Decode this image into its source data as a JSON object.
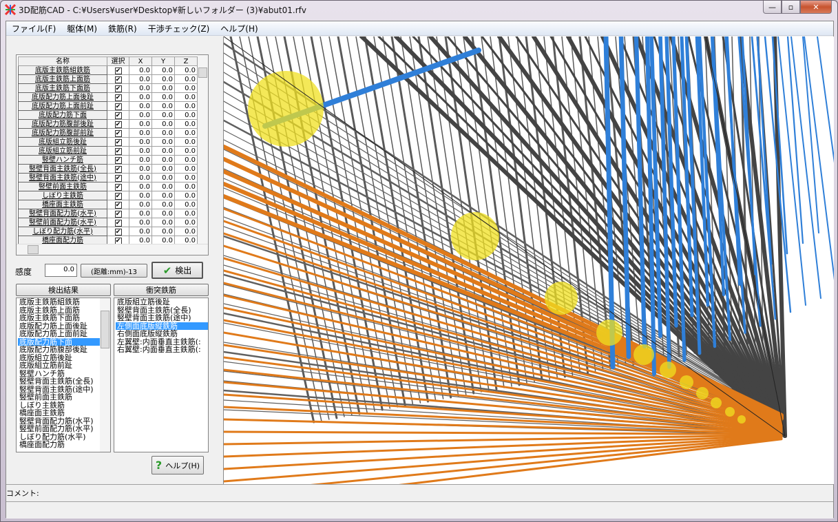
{
  "window": {
    "title": "3D配筋CAD - C:¥Users¥user¥Desktop¥新しいフォルダー (3)¥abut01.rfv",
    "minimize": "—",
    "maximize": "▫",
    "close": "✕"
  },
  "menu": [
    "ファイル(F)",
    "躯体(M)",
    "鉄筋(R)",
    "干渉チェック(Z)",
    "ヘルプ(H)"
  ],
  "table": {
    "headers": [
      "名称",
      "選択",
      "X",
      "Y",
      "Z"
    ],
    "rows": [
      "底版主鉄筋組鉄筋",
      "底版主鉄筋上面筋",
      "底版主鉄筋下面筋",
      "底版配力筋上面後趾",
      "底版配力筋上面前趾",
      "底版配力筋下面",
      "底版配力筋腹部後趾",
      "底版配力筋腹部前趾",
      "底版組立筋後趾",
      "底版組立筋前趾",
      "竪壁ハンチ筋",
      "竪壁背面主鉄筋(全長)",
      "竪壁背面主鉄筋(途中)",
      "竪壁前面主鉄筋",
      "しぼり主鉄筋",
      "橋座面主鉄筋",
      "竪壁背面配力筋(水平)",
      "竪壁前面配力筋(水平)",
      "しぼり配力筋(水平)",
      "橋座面配力筋"
    ],
    "checked": true,
    "x": "0.0",
    "y": "0.0",
    "z": "0.0"
  },
  "sensitivity": {
    "label": "感度",
    "value": "0.0",
    "unit": "(距離:mm)-13",
    "detect_button": "検出"
  },
  "results": {
    "header": "検出結果",
    "items": [
      "底版主鉄筋組鉄筋",
      "底版主鉄筋上面筋",
      "底版主鉄筋下面筋",
      "底版配力筋上面後趾",
      "底版配力筋上面前趾",
      "底版配力筋下面",
      "底版配力筋腹部後趾",
      "底版組立筋後趾",
      "底版組立筋前趾",
      "竪壁ハンチ筋",
      "竪壁背面主鉄筋(全長)",
      "竪壁背面主鉄筋(途中)",
      "竪壁前面主鉄筋",
      "しぼり主鉄筋",
      "橋座面主鉄筋",
      "竪壁背面配力筋(水平)",
      "竪壁前面配力筋(水平)",
      "しぼり配力筋(水平)",
      "橋座面配力筋"
    ],
    "selected": 5
  },
  "collisions": {
    "header": "衝突鉄筋",
    "items": [
      "底版組立筋後趾",
      "竪壁背面主鉄筋(全長)",
      "竪壁背面主鉄筋(途中)",
      "左側面底版縦鉄筋",
      "右側面底版縦鉄筋",
      "左翼壁:内面垂直主鉄筋(:",
      "右翼壁:内面垂直主鉄筋(:"
    ],
    "selected": 3
  },
  "help_button": "ヘルプ(H)",
  "comment_label": "コメント:",
  "colors": {
    "grey_bar": "#4a4a4a",
    "blue_bar": "#2f7fd8",
    "orange_bar": "#e07a1a",
    "collision": "#f0e020",
    "selection": "#3399ff"
  }
}
